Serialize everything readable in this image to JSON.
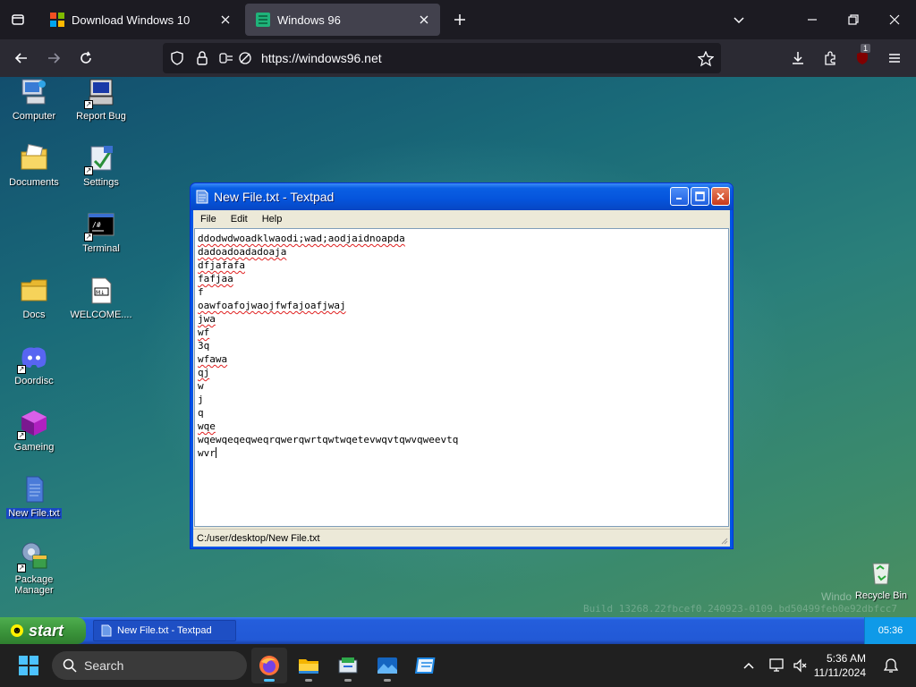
{
  "browser": {
    "tabs": [
      {
        "title": "Download Windows 10",
        "icon": "windows-logo-icon"
      },
      {
        "title": "Windows 96",
        "icon": "windows96-icon",
        "active": true
      }
    ],
    "url": "https://windows96.net",
    "notification_badge": "1"
  },
  "desktop": {
    "icons_left": [
      {
        "label": "Computer",
        "icon": "computer-icon"
      },
      {
        "label": "Documents",
        "icon": "documents-folder-icon"
      },
      {
        "label": "Docs",
        "icon": "folder-icon"
      },
      {
        "label": "Doordisc",
        "icon": "discord-icon"
      },
      {
        "label": "Gameing",
        "icon": "game-cube-icon"
      },
      {
        "label": "New File.txt",
        "icon": "text-file-icon"
      },
      {
        "label": "Package Manager",
        "icon": "package-manager-icon"
      }
    ],
    "icons_right": [
      {
        "label": "Report Bug",
        "icon": "report-bug-icon"
      },
      {
        "label": "Settings",
        "icon": "settings-icon"
      },
      {
        "label": "Terminal",
        "icon": "terminal-icon"
      },
      {
        "label": "WELCOME....",
        "icon": "markdown-file-icon"
      }
    ],
    "recycle_bin": "Recycle Bin",
    "watermark_windows": "Windo",
    "build_string": "Build 13268.22fbcef0.240923-0109.bd50499feb0e92dbfcc7"
  },
  "textpad": {
    "title": "New File.txt - Textpad",
    "menu": [
      "File",
      "Edit",
      "Help"
    ],
    "lines": [
      {
        "text": "ddodwdwoadklwaodi;wad;aodjaidnoapda",
        "spell_error": true
      },
      {
        "text": "dadoadoadadoaja",
        "spell_error": true
      },
      {
        "text": "dfjafafa",
        "spell_error": true
      },
      {
        "text": "fafjaa",
        "spell_error": true
      },
      {
        "text": "f",
        "spell_error": false
      },
      {
        "text": "oawfoafojwaojfwfajoafjwaj",
        "spell_error": true
      },
      {
        "text": "jwa",
        "spell_error": true
      },
      {
        "text": "wf",
        "spell_error": true
      },
      {
        "text": "3q",
        "spell_error": false
      },
      {
        "text": "wfawa",
        "spell_error": true
      },
      {
        "text": "qj",
        "spell_error": true
      },
      {
        "text": "w",
        "spell_error": false
      },
      {
        "text": "j",
        "spell_error": false
      },
      {
        "text": "q",
        "spell_error": false
      },
      {
        "text": "wqe",
        "spell_error": true
      },
      {
        "text": "wqewqeqeqweqrqwerqwrtqwtwqetevwqvtqwvqweevtq",
        "spell_error": false
      },
      {
        "text": "wvr",
        "spell_error": false
      }
    ],
    "status_path": "C:/user/desktop/New File.txt"
  },
  "w96_taskbar": {
    "start_label": "start",
    "task_item": "New File.txt - Textpad",
    "clock": "05:36"
  },
  "host_taskbar": {
    "search_label": "Search",
    "time": "5:36 AM",
    "date": "11/11/2024"
  }
}
